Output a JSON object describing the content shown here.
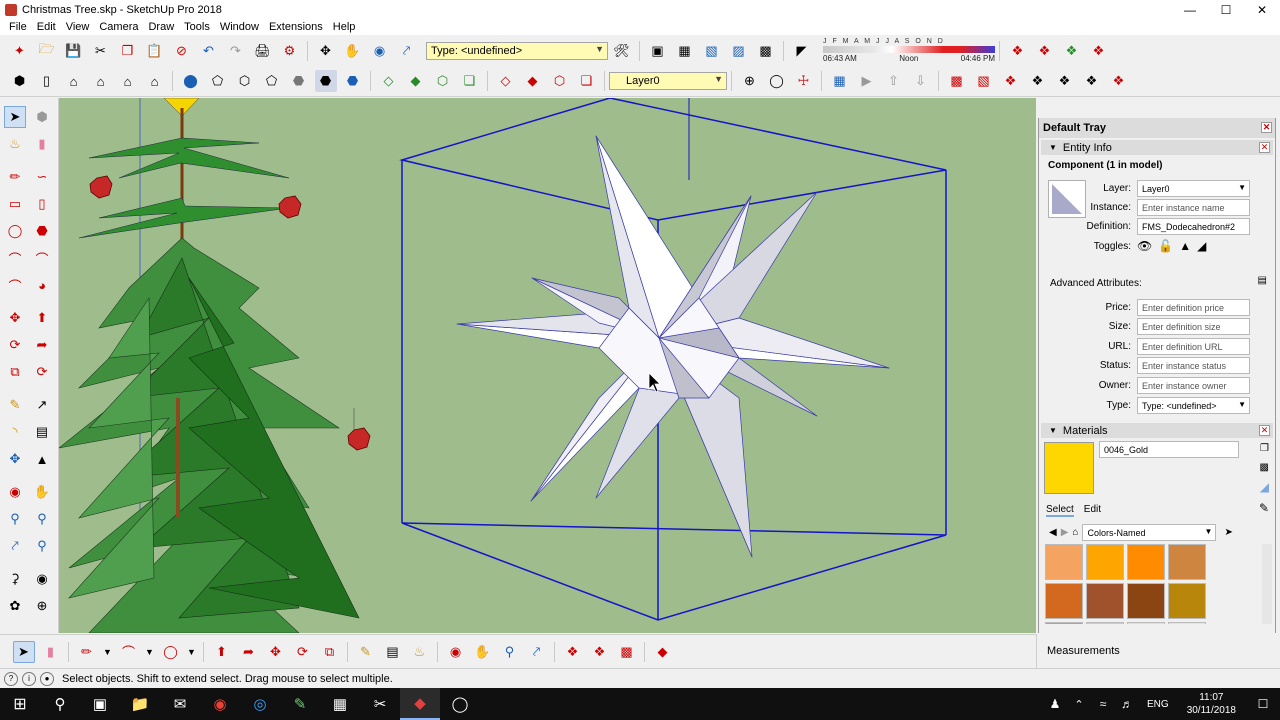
{
  "window": {
    "title": "Christmas Tree.skp - SketchUp Pro 2018",
    "minimize": "—",
    "maximize": "☐",
    "close": "✕"
  },
  "menu": [
    "File",
    "Edit",
    "View",
    "Camera",
    "Draw",
    "Tools",
    "Window",
    "Extensions",
    "Help"
  ],
  "toolbar": {
    "type_combo": "Type: <undefined>",
    "layer_combo": "Layer0",
    "shadow_ticks": "J F M A M J J A S O N D",
    "shadow_time_start": "06:43 AM",
    "shadow_time_noon": "Noon",
    "shadow_time_end": "04:46 PM"
  },
  "tray": {
    "title": "Default Tray",
    "entity_info": {
      "header": "Entity Info",
      "heading": "Component (1 in model)",
      "layer_label": "Layer:",
      "layer_value": "Layer0",
      "instance_label": "Instance:",
      "instance_placeholder": "Enter instance name",
      "definition_label": "Definition:",
      "definition_value": "FMS_Dodecahedron#2",
      "toggles_label": "Toggles:",
      "advanced_label": "Advanced Attributes:",
      "price_label": "Price:",
      "price_placeholder": "Enter definition price",
      "size_label": "Size:",
      "size_placeholder": "Enter definition size",
      "url_label": "URL:",
      "url_placeholder": "Enter definition URL",
      "status_label": "Status:",
      "status_placeholder": "Enter instance status",
      "owner_label": "Owner:",
      "owner_placeholder": "Enter instance owner",
      "type_label": "Type:",
      "type_value": "Type: <undefined>"
    },
    "materials": {
      "header": "Materials",
      "material_name": "0046_Gold",
      "swatch_color": "#FFD700",
      "tab_select": "Select",
      "tab_edit": "Edit",
      "library": "Colors-Named",
      "swatches": [
        "#F4A460",
        "#FFA500",
        "#FF8C00",
        "#CD853F",
        "#D2691E",
        "#A0522D",
        "#8B4513",
        "#B8860B",
        "#DAA520",
        "#FFD700",
        "#F0E68C",
        "#EEE8AA"
      ]
    }
  },
  "measurements_label": "Measurements",
  "status_text": "Select objects. Shift to extend select. Drag mouse to select multiple.",
  "taskbar": {
    "language": "ENG",
    "time": "11:07",
    "date": "30/11/2018"
  },
  "colors": {
    "viewport_bg": "#9FBD8C",
    "selection_blue": "#1414C8",
    "tree_green": "#2E7D32",
    "ornament_red": "#C62828"
  }
}
